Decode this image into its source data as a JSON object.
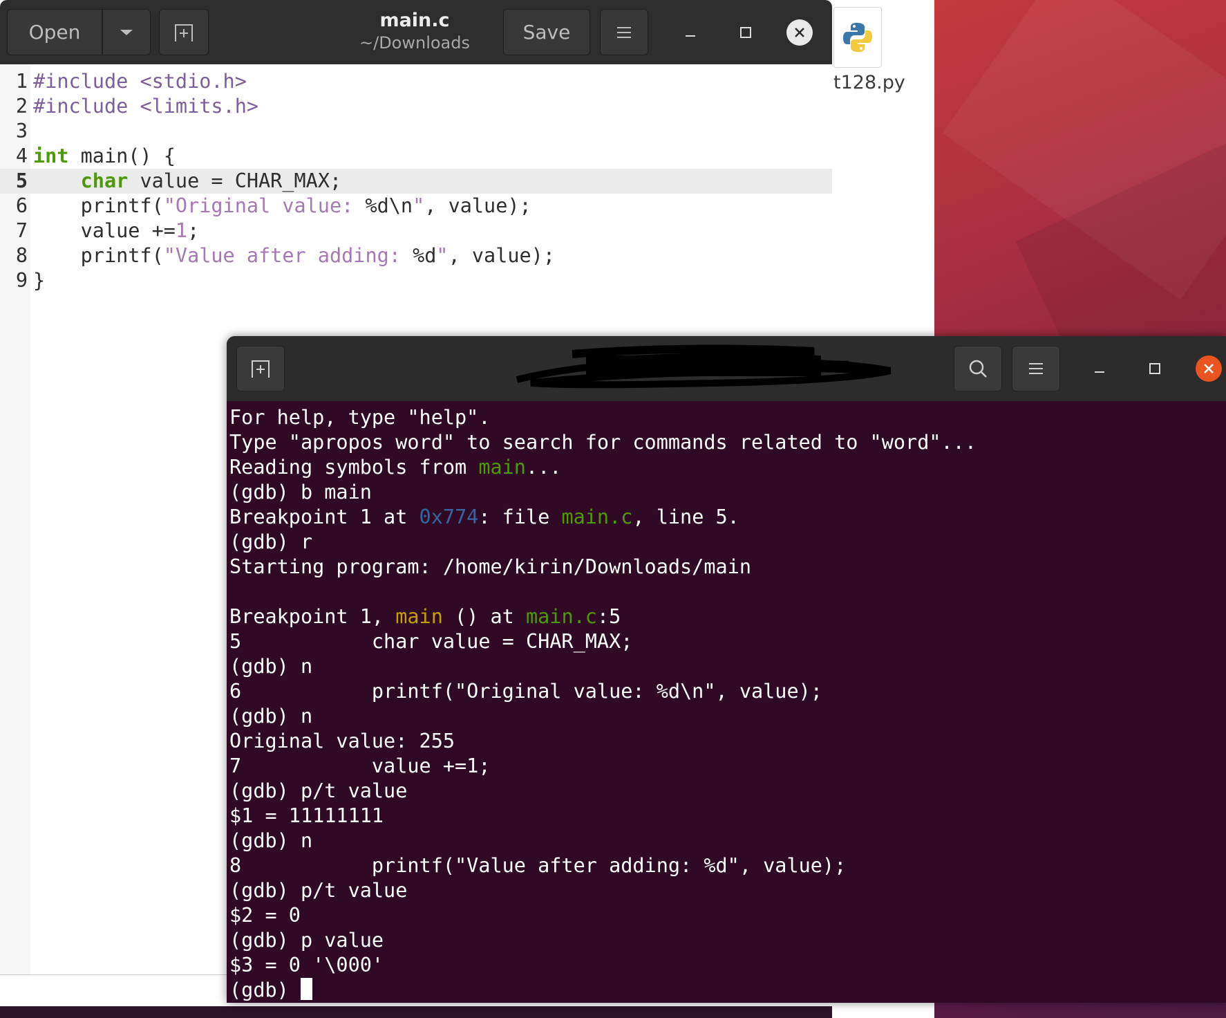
{
  "editor": {
    "open_label": "Open",
    "save_label": "Save",
    "title": "main.c",
    "subtitle": "~/Downloads",
    "code_lines": [
      {
        "num": "1",
        "segments": [
          {
            "t": "#include ",
            "c": "inc"
          },
          {
            "t": "<stdio.h>",
            "c": "inc"
          }
        ]
      },
      {
        "num": "2",
        "segments": [
          {
            "t": "#include ",
            "c": "inc"
          },
          {
            "t": "<limits.h>",
            "c": "inc"
          }
        ]
      },
      {
        "num": "3",
        "segments": []
      },
      {
        "num": "4",
        "segments": [
          {
            "t": "int",
            "c": "kw"
          },
          {
            "t": " main() {",
            "c": ""
          }
        ]
      },
      {
        "num": "5",
        "current": true,
        "segments": [
          {
            "t": "    ",
            "c": ""
          },
          {
            "t": "char",
            "c": "kw"
          },
          {
            "t": " value = CHAR_MAX;",
            "c": ""
          }
        ]
      },
      {
        "num": "6",
        "segments": [
          {
            "t": "    printf(",
            "c": ""
          },
          {
            "t": "\"Original value: ",
            "c": "str"
          },
          {
            "t": "%d\\n",
            "c": ""
          },
          {
            "t": "\"",
            "c": "str"
          },
          {
            "t": ", value);",
            "c": ""
          }
        ]
      },
      {
        "num": "7",
        "segments": [
          {
            "t": "    value +=",
            "c": ""
          },
          {
            "t": "1",
            "c": "num"
          },
          {
            "t": ";",
            "c": ""
          }
        ]
      },
      {
        "num": "8",
        "segments": [
          {
            "t": "    printf(",
            "c": ""
          },
          {
            "t": "\"Value after adding: ",
            "c": "str"
          },
          {
            "t": "%d",
            "c": ""
          },
          {
            "t": "\"",
            "c": "str"
          },
          {
            "t": ", value);",
            "c": ""
          }
        ]
      },
      {
        "num": "9",
        "segments": [
          {
            "t": "}",
            "c": ""
          }
        ]
      }
    ]
  },
  "desktop": {
    "file_name": "t128.py",
    "file_icon": "python-icon"
  },
  "terminal": {
    "title": "",
    "lines": [
      [
        {
          "t": "For help, type \"help\".",
          "c": ""
        }
      ],
      [
        {
          "t": "Type \"apropos word\" to search for commands related to \"word\"...",
          "c": ""
        }
      ],
      [
        {
          "t": "Reading symbols from ",
          "c": ""
        },
        {
          "t": "main",
          "c": "g"
        },
        {
          "t": "...",
          "c": ""
        }
      ],
      [
        {
          "t": "(gdb) b main",
          "c": ""
        }
      ],
      [
        {
          "t": "Breakpoint 1 at ",
          "c": ""
        },
        {
          "t": "0x774",
          "c": "b"
        },
        {
          "t": ": file ",
          "c": ""
        },
        {
          "t": "main.c",
          "c": "g"
        },
        {
          "t": ", line 5.",
          "c": ""
        }
      ],
      [
        {
          "t": "(gdb) r",
          "c": ""
        }
      ],
      [
        {
          "t": "Starting program: /home/kirin/Downloads/main",
          "c": ""
        }
      ],
      [],
      [
        {
          "t": "Breakpoint 1, ",
          "c": ""
        },
        {
          "t": "main",
          "c": "y"
        },
        {
          "t": " () at ",
          "c": ""
        },
        {
          "t": "main.c",
          "c": "g"
        },
        {
          "t": ":5",
          "c": ""
        }
      ],
      [
        {
          "t": "5           char value = CHAR_MAX;",
          "c": ""
        }
      ],
      [
        {
          "t": "(gdb) n",
          "c": ""
        }
      ],
      [
        {
          "t": "6           printf(\"Original value: %d\\n\", value);",
          "c": ""
        }
      ],
      [
        {
          "t": "(gdb) n",
          "c": ""
        }
      ],
      [
        {
          "t": "Original value: 255",
          "c": ""
        }
      ],
      [
        {
          "t": "7           value +=1;",
          "c": ""
        }
      ],
      [
        {
          "t": "(gdb) p/t value",
          "c": ""
        }
      ],
      [
        {
          "t": "$1 = 11111111",
          "c": ""
        }
      ],
      [
        {
          "t": "(gdb) n",
          "c": ""
        }
      ],
      [
        {
          "t": "8           printf(\"Value after adding: %d\", value);",
          "c": ""
        }
      ],
      [
        {
          "t": "(gdb) p/t value",
          "c": ""
        }
      ],
      [
        {
          "t": "$2 = 0",
          "c": ""
        }
      ],
      [
        {
          "t": "(gdb) p value",
          "c": ""
        }
      ],
      [
        {
          "t": "$3 = 0 '\\000'",
          "c": ""
        }
      ],
      [
        {
          "t": "(gdb) ",
          "c": ""
        },
        {
          "t": "",
          "c": "cursor"
        }
      ]
    ]
  },
  "colors": {
    "terminal_bg": "#300a24",
    "header_bg": "#2d2d2d",
    "close_accent": "#e95420",
    "keyword": "#4e9a06",
    "string": "#a678b5"
  }
}
